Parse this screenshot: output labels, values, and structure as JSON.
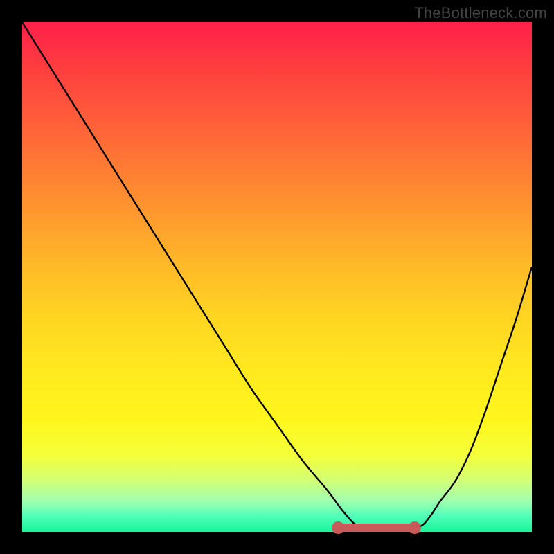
{
  "watermark": "TheBottleneck.com",
  "colors": {
    "frame": "#000000",
    "gradient_top": "#ff1f4b",
    "gradient_bottom": "#18f59a",
    "curve": "#000000",
    "marker": "#c85a5a"
  },
  "chart_data": {
    "type": "line",
    "title": "",
    "xlabel": "",
    "ylabel": "",
    "xlim": [
      0,
      100
    ],
    "ylim": [
      0,
      100
    ],
    "series": [
      {
        "name": "bottleneck-curve",
        "x": [
          0,
          5,
          10,
          15,
          20,
          25,
          30,
          35,
          40,
          45,
          50,
          55,
          60,
          63,
          66,
          70,
          74,
          78,
          80,
          82,
          85,
          88,
          91,
          94,
          97,
          100
        ],
        "values": [
          100,
          92,
          84,
          76,
          68,
          60,
          52,
          44,
          36,
          28,
          21,
          14,
          8,
          4,
          1,
          0,
          0,
          1,
          3,
          6,
          10,
          16,
          24,
          33,
          42,
          52
        ]
      }
    ],
    "annotations": [
      {
        "name": "optimal-marker",
        "type": "segment-with-endpoints",
        "x_start": 62,
        "x_end": 77,
        "y": 0,
        "color": "#c85a5a"
      }
    ]
  }
}
